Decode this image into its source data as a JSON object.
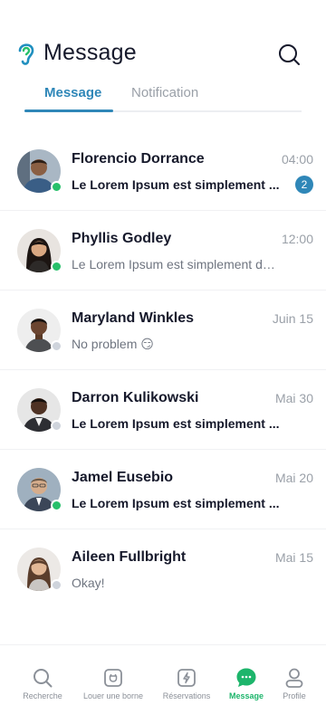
{
  "header": {
    "title": "Message"
  },
  "tabs": [
    {
      "label": "Message",
      "active": true
    },
    {
      "label": "Notification",
      "active": false
    }
  ],
  "conversations": [
    {
      "name": "Florencio Dorrance",
      "time": "04:00",
      "preview": "Le Lorem Ipsum est simplement ...",
      "unread": true,
      "badge": "2",
      "online": true
    },
    {
      "name": "Phyllis Godley",
      "time": "12:00",
      "preview": "Le Lorem Ipsum est simplement du ...",
      "unread": false,
      "online": true
    },
    {
      "name": "Maryland Winkles",
      "time": "Juin 15",
      "preview": "No problem 😏",
      "unread": false,
      "online": false
    },
    {
      "name": "Darron Kulikowski",
      "time": "Mai 30",
      "preview": "Le Lorem Ipsum est simplement ...",
      "unread": true,
      "online": false
    },
    {
      "name": "Jamel Eusebio",
      "time": "Mai 20",
      "preview": "Le Lorem Ipsum est simplement ...",
      "unread": true,
      "online": true
    },
    {
      "name": "Aileen Fullbright",
      "time": "Mai 15",
      "preview": "Okay!",
      "unread": false,
      "online": false
    }
  ],
  "bottom_nav": [
    {
      "label": "Recherche",
      "icon": "search-icon",
      "active": false
    },
    {
      "label": "Louer une borne",
      "icon": "plug-icon",
      "active": false
    },
    {
      "label": "Réservations",
      "icon": "bolt-icon",
      "active": false
    },
    {
      "label": "Message",
      "icon": "chat-icon",
      "active": true
    },
    {
      "label": "Profile",
      "icon": "user-icon",
      "active": false
    }
  ],
  "colors": {
    "accent": "#2f87b8",
    "active_nav": "#1db56b",
    "online": "#27c06a",
    "offline": "#cfd4dc"
  }
}
